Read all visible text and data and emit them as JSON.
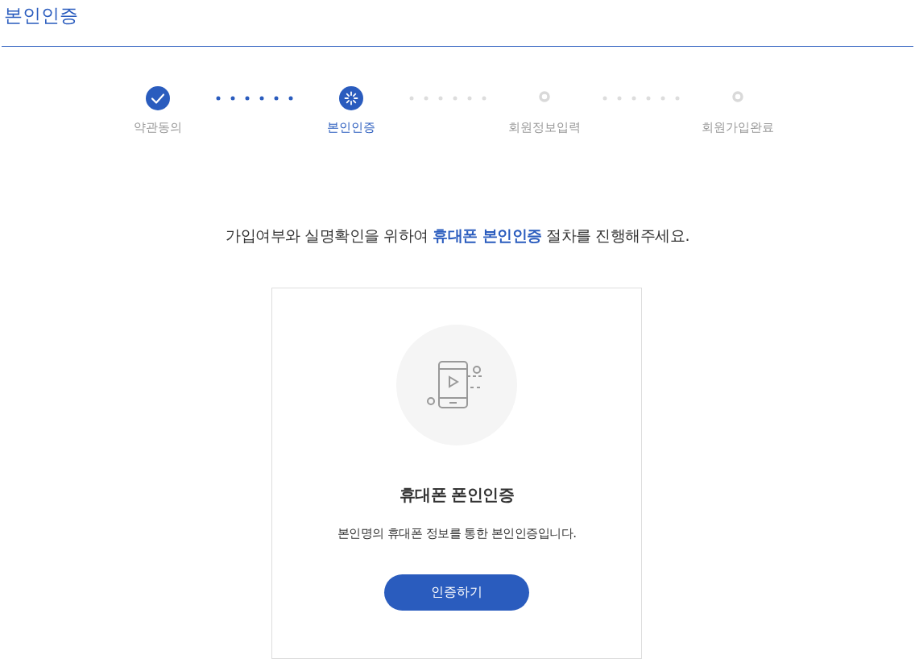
{
  "page_title": "본인인증",
  "steps": [
    {
      "label": "약관동의",
      "kind": "done"
    },
    {
      "label": "본인인증",
      "kind": "current"
    },
    {
      "label": "회원정보입력",
      "kind": "todo"
    },
    {
      "label": "회원가입완료",
      "kind": "todo"
    }
  ],
  "headline": "가입여부와 실명확인을 위하여 **휴대폰 본인인증** 절차를 진행해주세요.",
  "card": {
    "title": "휴대폰 폰인인증",
    "description": "본인명의 휴대폰 정보를 통한 본인인증입니다.",
    "button": "인증하기"
  }
}
